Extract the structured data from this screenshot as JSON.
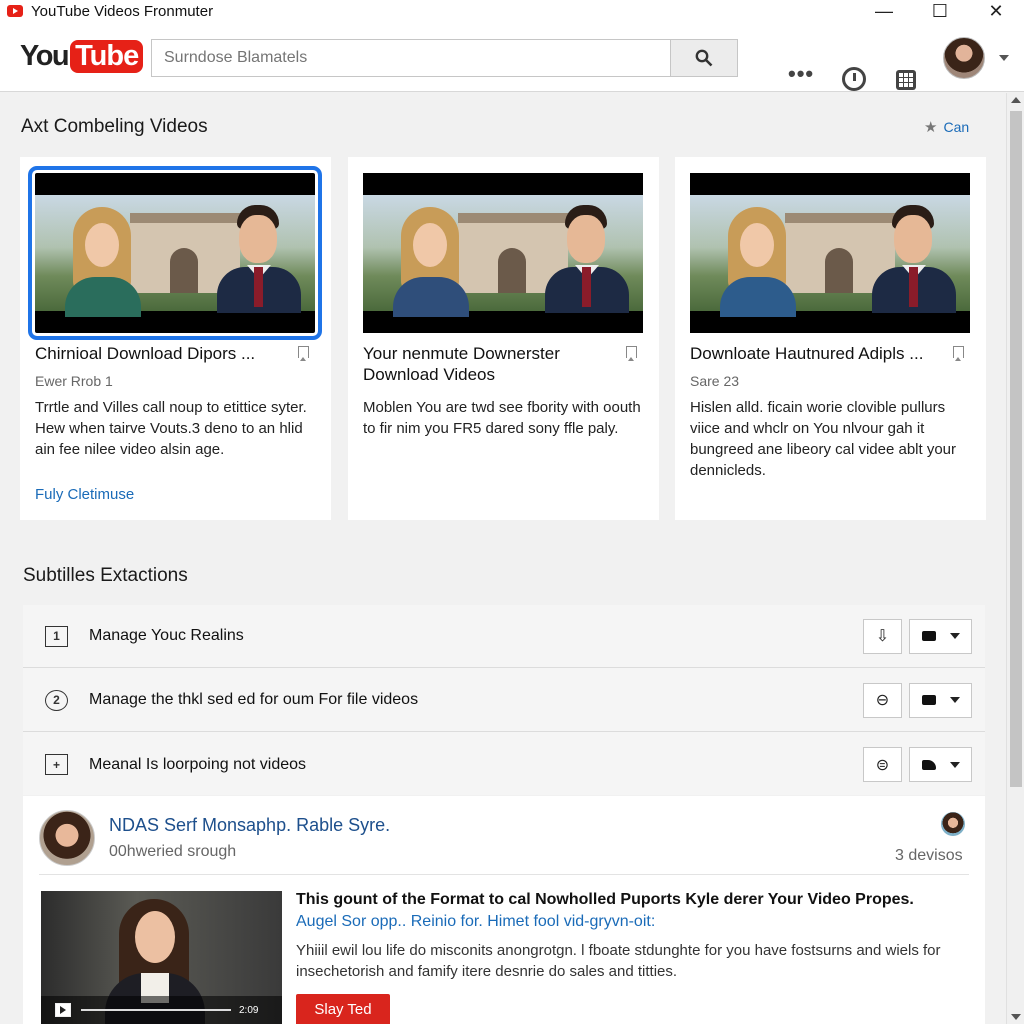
{
  "window": {
    "title": "YouTube Videos Fronmuter",
    "minimize": "—",
    "maximize": "☐",
    "close": "✕"
  },
  "header": {
    "logo_you": "You",
    "logo_tube": "Tube",
    "search_placeholder": "Surndose Blamatels",
    "more_label": "•••"
  },
  "section1": {
    "title": "Axt Combeling Videos",
    "action_label": "Can",
    "cards": [
      {
        "title": "Chirnioal Download Dipors ...",
        "meta": "Ewer Rrob 1",
        "desc": "Trrtle and Villes call noup to etittice syter. Hew when tairve Vouts.3 deno to an hlid ain fee nilee video alsin age.",
        "link": "Fuly Cletimuse"
      },
      {
        "title": "Your nenmute Downerster Download Videos",
        "meta": "",
        "desc": "Moblen You are twd see fbority with oouth to fir nim you FR5 dared sony ffle paly.",
        "link": ""
      },
      {
        "title": "Downloate Hautnured Adipls ...",
        "meta": "Sare 23",
        "desc": "Hislen alld. ficain worie clovible pullurs viice and whclr on You nlvour gah it bungreed ane libeory cal videe ablt your dennicleds.",
        "link": ""
      }
    ]
  },
  "section2": {
    "title": "Subtilles Extactions",
    "rows": [
      {
        "icon": "1",
        "label": "Manage Youc Realins",
        "action_glyph": "⇩"
      },
      {
        "icon": "2",
        "label": "Manage the thkl sed ed for oum For file videos",
        "action_glyph": "⊖"
      },
      {
        "icon": "+",
        "label": "Meanal Is loorpoing not videos",
        "action_glyph": "⊜"
      }
    ]
  },
  "feature": {
    "name": "NDAS Serf Monsaphp. Rable Syre.",
    "subtitle": "00hweried srough",
    "count": "3 devisos",
    "video_time": "2:09",
    "headline": "This gount of the Format to cal Nowholled Puports Kyle derer Your Video Propes.",
    "link": "Augel Sor opp.. Reinio for.  Himet fool vid-gryvn-oit:",
    "desc": "Yhiiil ewil lou life do misconits anongrotgn. l fboate stdunghte for you have fostsurns and wiels for insechetorish and famify itere desnrie do sales and titties.",
    "button": "Slay Ted"
  },
  "colors": {
    "accent_red": "#e62117",
    "link_blue": "#1a6bb8",
    "selection_blue": "#1f74e8"
  }
}
